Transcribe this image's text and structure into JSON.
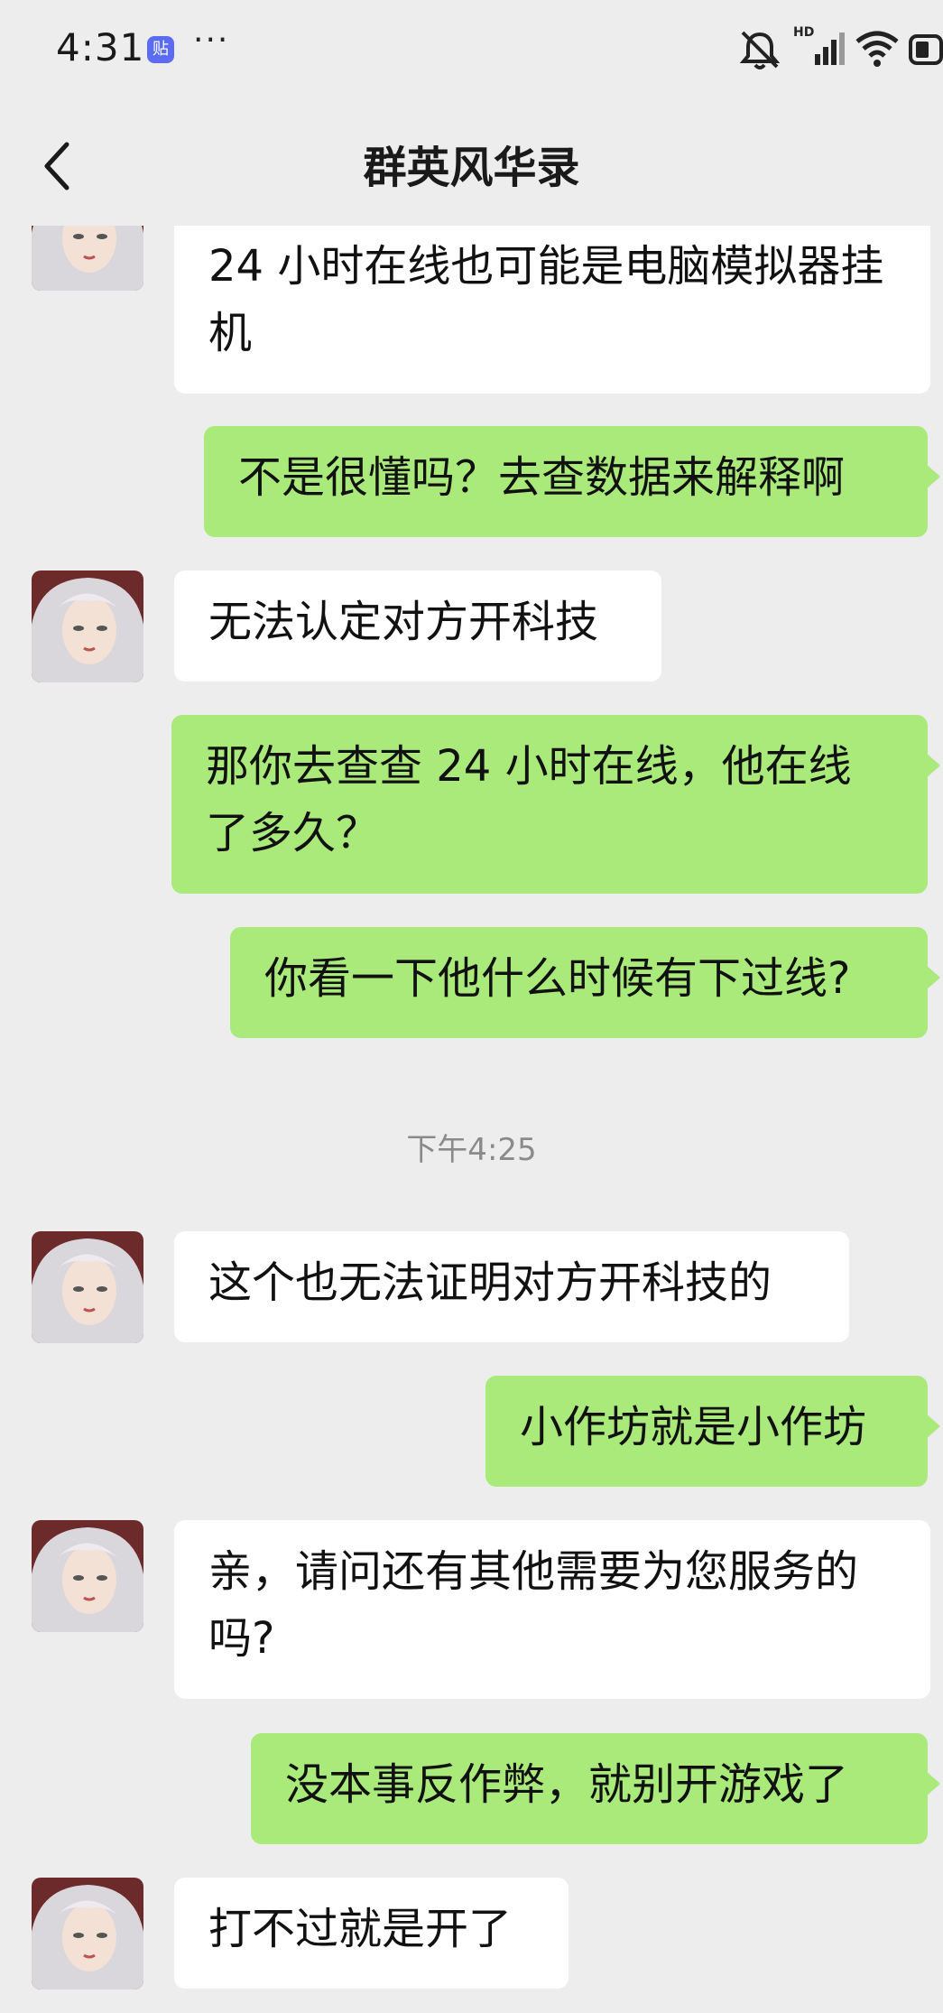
{
  "status_bar": {
    "time": "4:31",
    "badge": "贴",
    "more": "···",
    "network": "HD"
  },
  "header": {
    "title": "群英风华录"
  },
  "messages": [
    {
      "side": "left",
      "text": "24 小时在线也可能是电脑模拟器挂机"
    },
    {
      "side": "right",
      "text": "不是很懂吗？去查数据来解释啊"
    },
    {
      "side": "left",
      "text": "无法认定对方开科技"
    },
    {
      "side": "right",
      "text": "那你去查查 24 小时在线，他在线了多久？"
    },
    {
      "side": "right",
      "text": "你看一下他什么时候有下过线?"
    },
    {
      "type": "timestamp",
      "text": "下午4:25"
    },
    {
      "side": "left",
      "text": "这个也无法证明对方开科技的"
    },
    {
      "side": "right",
      "text": "小作坊就是小作坊"
    },
    {
      "side": "left",
      "text": "亲，请问还有其他需要为您服务的吗?"
    },
    {
      "side": "right",
      "text": "没本事反作弊，就别开游戏了"
    },
    {
      "side": "left",
      "text": "打不过就是开了"
    }
  ]
}
